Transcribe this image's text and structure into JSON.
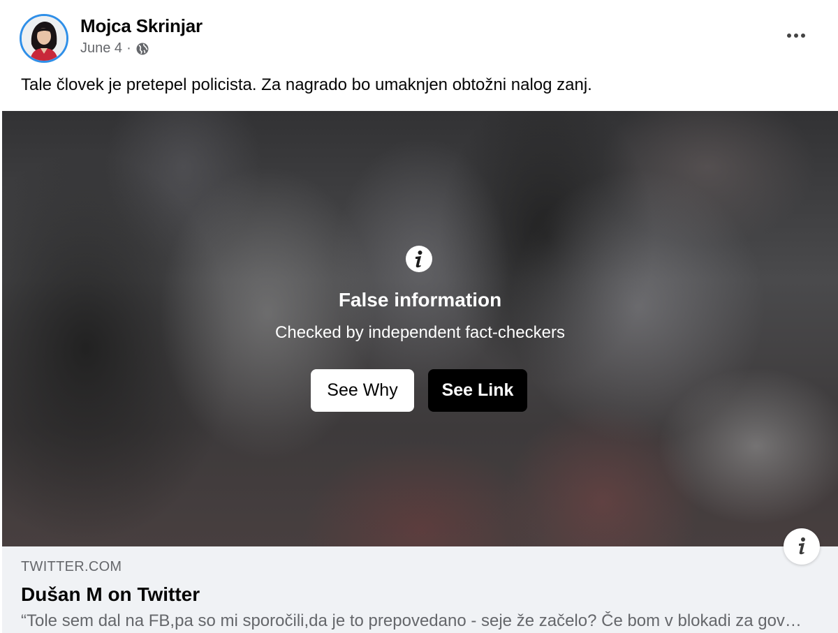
{
  "post": {
    "author": "Mojca Skrinjar",
    "date": "June 4",
    "separator": "·",
    "privacy_icon": "globe-icon",
    "text": "Tale človek je pretepel policista. Za nagrado bo umaknjen obtožni nalog zanj.",
    "more_icon": "more-options-icon"
  },
  "media": {
    "warning_icon": "info-icon",
    "warning_title": "False information",
    "warning_subtitle": "Checked by independent fact-checkers",
    "see_why_label": "See Why",
    "see_link_label": "See Link"
  },
  "link_preview": {
    "domain": "TWITTER.COM",
    "title": "Dušan M on Twitter",
    "description": "“Tole sem dal na FB,pa so mi sporočili,da je to prepovedano - seje že začelo? Če bom v blokadi za govorjenje resnice…",
    "info_icon": "info-icon"
  },
  "colors": {
    "avatar_ring": "#2f8fe8",
    "meta_text": "#65676b",
    "preview_bg": "#f0f2f5"
  }
}
